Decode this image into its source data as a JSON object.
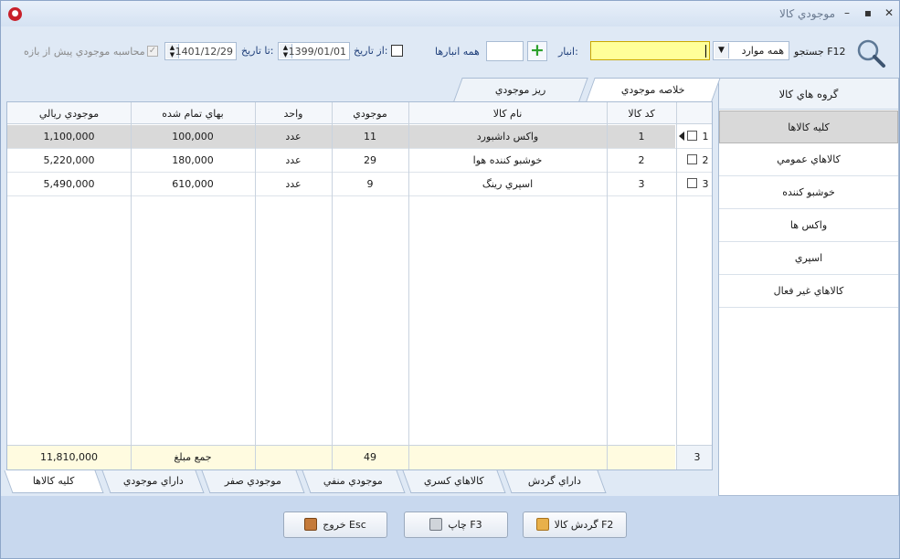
{
  "window": {
    "title": "موجودي كالا",
    "minimize_glyph": "–",
    "maximize_glyph": "▪",
    "close_glyph": "✕"
  },
  "toolbar": {
    "search_label": "جستجو F12",
    "search_mode": "همه موارد",
    "search_value": "",
    "warehouse_label": "انبار:",
    "warehouse_value": "",
    "all_warehouses_label": "همه انبارها",
    "from_date_label": "از تاريخ:",
    "from_date": "1399/01/01",
    "to_date_label": "تا تاريخ:",
    "to_date": "1401/12/29",
    "pre_range_label": "محاسبه موجودي پيش از بازه"
  },
  "tabs_top": [
    "خلاصه موجودي",
    "ريز موجودي"
  ],
  "groups": {
    "header": "گروه هاي كالا",
    "items": [
      "كليه كالاها",
      "كالاهاي عمومي",
      "خوشبو كننده",
      "واكس ها",
      "اسپري",
      "كالاهاي غير فعال"
    ]
  },
  "grid": {
    "columns": {
      "code": "كد كالا",
      "name": "نام كالا",
      "stock": "موجودي",
      "unit": "واحد",
      "cost": "بهاي تمام شده",
      "value": "موجودي ريالي"
    },
    "rows": [
      {
        "num": "1",
        "code": "1",
        "name": "واكس داشبورد",
        "stock": "11",
        "unit": "عدد",
        "cost": "100,000",
        "value": "1,100,000"
      },
      {
        "num": "2",
        "code": "2",
        "name": "خوشبو كننده هوا",
        "stock": "29",
        "unit": "عدد",
        "cost": "180,000",
        "value": "5,220,000"
      },
      {
        "num": "3",
        "code": "3",
        "name": "اسپري رينگ",
        "stock": "9",
        "unit": "عدد",
        "cost": "610,000",
        "value": "5,490,000"
      }
    ],
    "footer": {
      "count": "3",
      "stock_total": "49",
      "sum_label": "جمع مبلغ",
      "value_total": "11,810,000"
    }
  },
  "tabs_bottom": [
    "كليه كالاها",
    "داراي موجودي",
    "موجودي صفر",
    "موجودي منفي",
    "كالاهاي كسري",
    "داراي گردش"
  ],
  "buttons": {
    "turnover": "گردش كالا F2",
    "print": "چاپ F3",
    "exit": "خروج Esc"
  }
}
